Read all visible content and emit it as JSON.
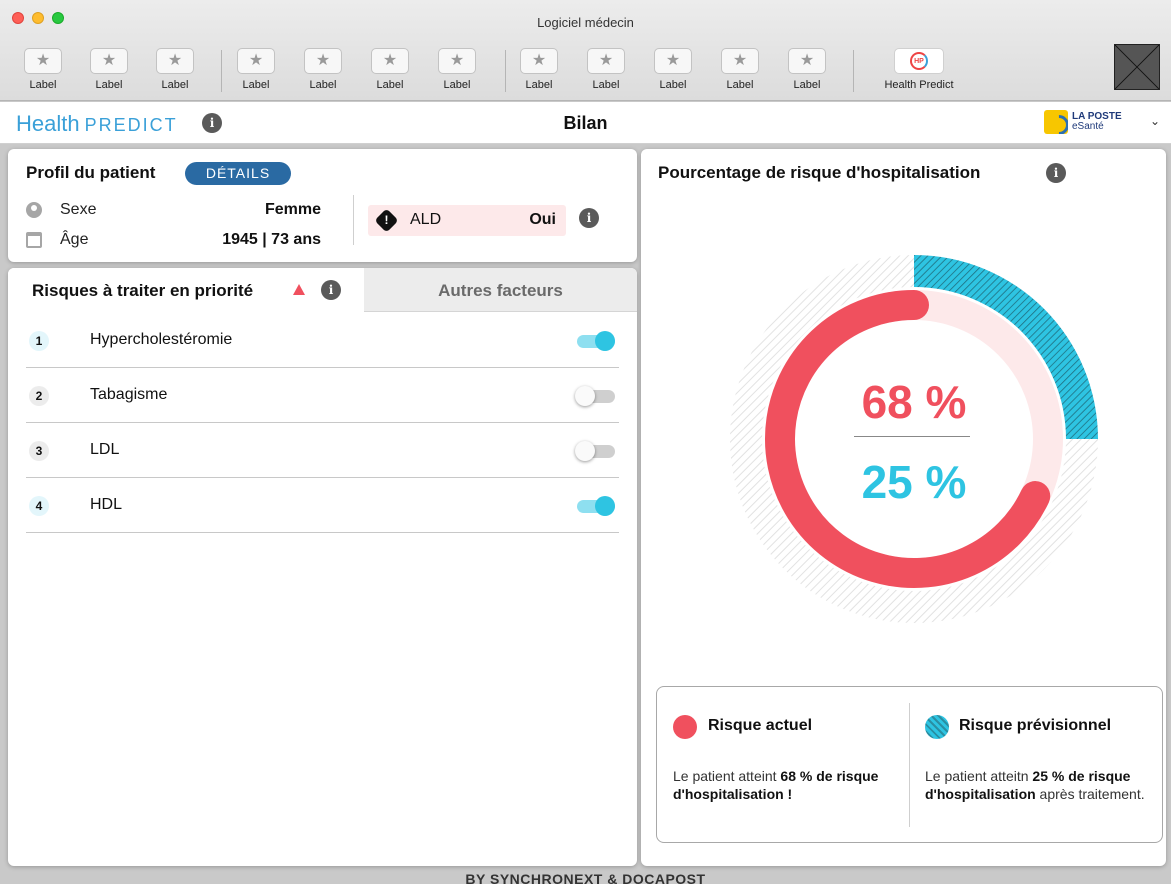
{
  "window": {
    "title": "Logiciel médecin"
  },
  "toolbar": {
    "buttons": [
      {
        "label": "Label"
      },
      {
        "label": "Label"
      },
      {
        "label": "Label"
      },
      {
        "label": "Label"
      },
      {
        "label": "Label"
      },
      {
        "label": "Label"
      },
      {
        "label": "Label"
      },
      {
        "label": "Label"
      },
      {
        "label": "Label"
      },
      {
        "label": "Label"
      },
      {
        "label": "Label"
      },
      {
        "label": "Label"
      }
    ],
    "app_button_label": "Health Predict",
    "app_button_logo": "HP"
  },
  "header": {
    "brand_part1": "Health",
    "brand_part2": "PREDICT",
    "page_title": "Bilan",
    "partner_line1": "LA POSTE",
    "partner_line2": "eSanté"
  },
  "profil": {
    "title": "Profil du patient",
    "details_label": "DÉTAILS",
    "sexe_label": "Sexe",
    "sexe_value": "Femme",
    "age_label": "Âge",
    "age_value": "1945 | 73 ans",
    "ald_label": "ALD",
    "ald_value": "Oui"
  },
  "tabs": {
    "active_label": "Risques à traiter en priorité",
    "inactive_label": "Autres facteurs"
  },
  "risks": [
    {
      "num": "1",
      "name": "Hypercholestéromie",
      "enabled": true
    },
    {
      "num": "2",
      "name": "Tabagisme",
      "enabled": false
    },
    {
      "num": "3",
      "name": "LDL",
      "enabled": false
    },
    {
      "num": "4",
      "name": "HDL",
      "enabled": true
    }
  ],
  "risk_panel": {
    "title": "Pourcentage de risque d'hospitalisation",
    "actuel_pct": "68 %",
    "prev_pct": "25 %",
    "actuel_value": 68,
    "prev_value": 25,
    "colors": {
      "actuel": "#f0505e",
      "previsionnel": "#2ec4e2",
      "track": "#fde9ea"
    },
    "legend": {
      "actuel_title": "Risque actuel",
      "actuel_text_1": "Le patient atteint ",
      "actuel_text_bold": "68 % de risque d'hospitalisation !",
      "prev_title": "Risque prévisionnel",
      "prev_text_1": "Le patient atteitn ",
      "prev_text_bold": "25 % de risque d'hospitalisation",
      "prev_text_2": " après traitement."
    }
  },
  "footer": {
    "text": "BY SYNCHRONEXT & DOCAPOST"
  }
}
